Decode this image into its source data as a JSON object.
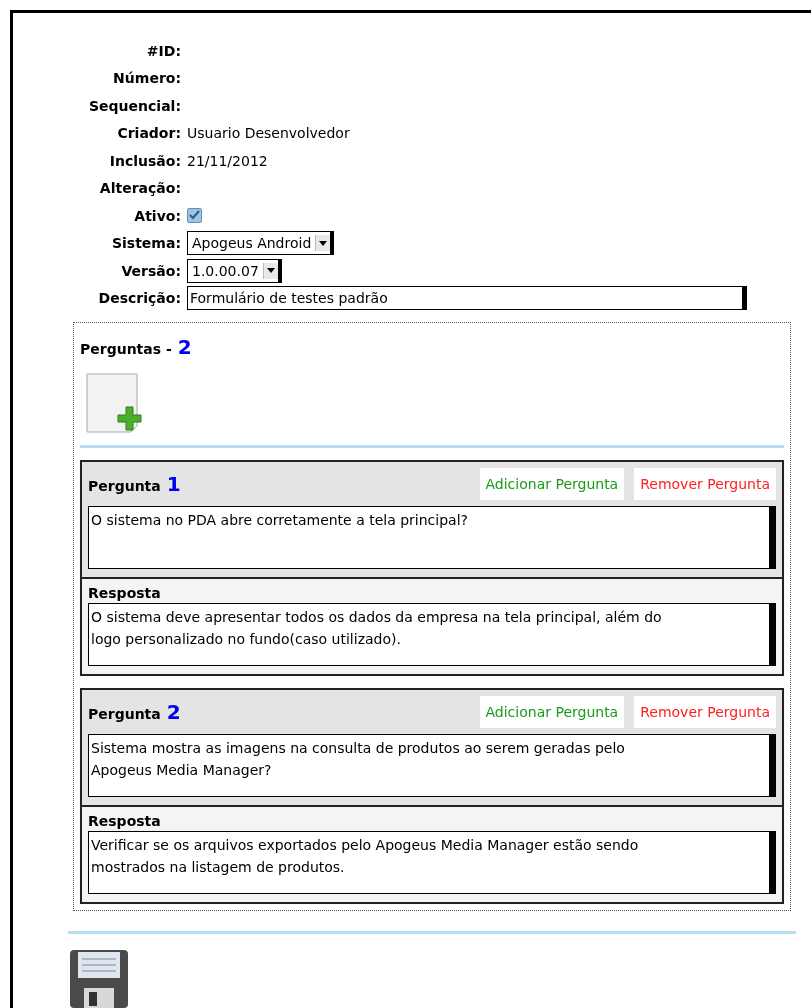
{
  "fields": [
    {
      "label": "#ID:",
      "kind": "text"
    },
    {
      "label": "Número:",
      "kind": "text"
    },
    {
      "label": "Sequencial:",
      "kind": "text"
    },
    {
      "label": "Criador:",
      "kind": "text",
      "value": "Usuario Desenvolvedor"
    },
    {
      "label": "Inclusão:",
      "kind": "text",
      "value": "21/11/2012"
    },
    {
      "label": "Alteração:",
      "kind": "text"
    },
    {
      "label": "Ativo:",
      "kind": "checkbox",
      "checked": true
    },
    {
      "label": "Sistema:",
      "kind": "select",
      "value": "Apogeus Android"
    },
    {
      "label": "Versão:",
      "kind": "select",
      "value": "1.0.00.07"
    },
    {
      "label": "Descrição:",
      "kind": "input",
      "value": "Formulário de testes padrão"
    }
  ],
  "questions_section": {
    "title": "Perguntas -",
    "count": "2",
    "questions": [
      {
        "label": "Pergunta",
        "number": "1",
        "add_button": "Adicionar Pergunta",
        "remove_button": "Remover Pergunta",
        "question": "O sistema no PDA abre corretamente a tela principal?",
        "answer_label": "Resposta",
        "answer": "O sistema deve apresentar todos os dados da empresa na tela principal, além do logo personalizado no fundo(caso utilizado)."
      },
      {
        "label": "Pergunta",
        "number": "2",
        "add_button": "Adicionar Pergunta",
        "remove_button": "Remover Pergunta",
        "question": "Sistema mostra as imagens na consulta de produtos ao serem geradas pelo Apogeus Media Manager?",
        "answer_label": "Resposta",
        "answer": "Verificar se os arquivos exportados pelo Apogeus Media Manager estão sendo mostrados na listagem de produtos."
      }
    ]
  }
}
